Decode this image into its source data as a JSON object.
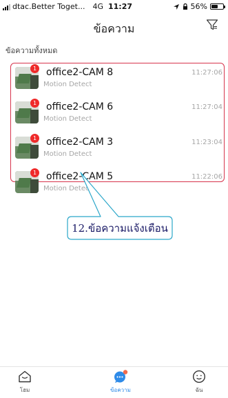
{
  "status_bar": {
    "carrier": "dtac.Better Toget...",
    "network": "4G",
    "time": "11:27",
    "battery_text": "56%",
    "battery_level": 0.56
  },
  "header": {
    "title": "ข้อความ",
    "filter_icon": "filter-icon"
  },
  "section_label": "ข้อความทั้งหมด",
  "messages": [
    {
      "title": "office2-CAM 8",
      "subtitle": "Motion Detect",
      "time": "11:27:06",
      "badge": "1"
    },
    {
      "title": "office2-CAM 6",
      "subtitle": "Motion Detect",
      "time": "11:27:04",
      "badge": "1"
    },
    {
      "title": "office2-CAM 3",
      "subtitle": "Motion Detect",
      "time": "11:23:04",
      "badge": "1"
    },
    {
      "title": "office2-CAM 5",
      "subtitle": "Motion Detect",
      "time": "11:22:06",
      "badge": "1"
    }
  ],
  "callout": "12.ข้อความแจ้งเตือน",
  "tabs": [
    {
      "label": "โฮม",
      "icon": "home-icon",
      "active": false
    },
    {
      "label": "ข้อความ",
      "icon": "message-icon",
      "active": true
    },
    {
      "label": "ฉัน",
      "icon": "profile-icon",
      "active": false
    }
  ],
  "colors": {
    "accent": "#2f8be8",
    "badge": "#ef2a2a",
    "highlight_border": "#d6334b",
    "callout_border": "#2aa6c9"
  }
}
